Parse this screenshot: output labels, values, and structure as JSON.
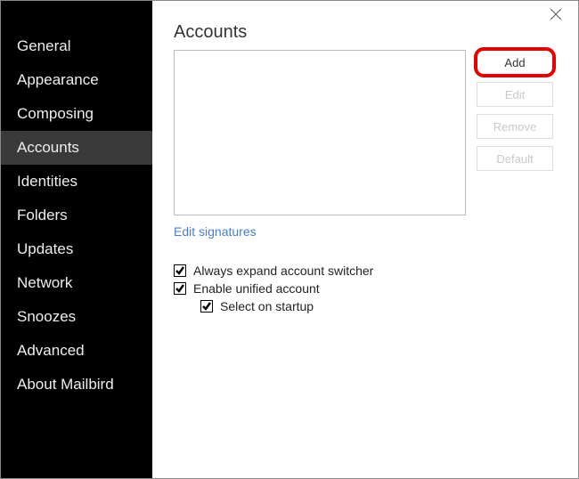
{
  "sidebar": {
    "items": [
      {
        "label": "General"
      },
      {
        "label": "Appearance"
      },
      {
        "label": "Composing"
      },
      {
        "label": "Accounts",
        "active": true
      },
      {
        "label": "Identities"
      },
      {
        "label": "Folders"
      },
      {
        "label": "Updates"
      },
      {
        "label": "Network"
      },
      {
        "label": "Snoozes"
      },
      {
        "label": "Advanced"
      },
      {
        "label": "About Mailbird"
      }
    ]
  },
  "main": {
    "title": "Accounts",
    "buttons": {
      "add": "Add",
      "edit": "Edit",
      "remove": "Remove",
      "default": "Default"
    },
    "edit_signatures_link": "Edit signatures",
    "options": {
      "always_expand": {
        "label": "Always expand account switcher",
        "checked": true
      },
      "enable_unified": {
        "label": "Enable unified account",
        "checked": true
      },
      "select_on_startup": {
        "label": "Select on startup",
        "checked": true
      }
    }
  }
}
